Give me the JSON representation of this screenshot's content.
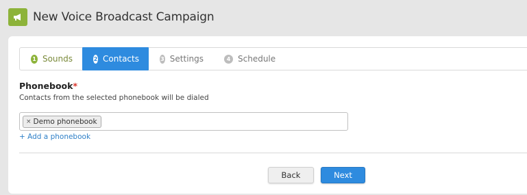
{
  "header": {
    "title": "New Voice Broadcast Campaign",
    "icon": "megaphone-icon",
    "icon_color": "#8db33a"
  },
  "tabs": [
    {
      "number": "1",
      "label": "Sounds",
      "state": "completed"
    },
    {
      "number": "2",
      "label": "Contacts",
      "state": "active"
    },
    {
      "number": "3",
      "label": "Settings",
      "state": "pending"
    },
    {
      "number": "4",
      "label": "Schedule",
      "state": "pending"
    }
  ],
  "form": {
    "label": "Phonebook",
    "required_marker": "*",
    "help_text": "Contacts from the selected phonebook will be dialed",
    "selected_tags": [
      {
        "remove": "×",
        "label": "Demo phonebook"
      }
    ],
    "add_link": "+ Add a phonebook"
  },
  "buttons": {
    "back_label": "Back",
    "next_label": "Next"
  },
  "colors": {
    "accent": "#2e8bdf",
    "success": "#8db33a",
    "required": "#d9342b",
    "link": "#2e7fc7"
  }
}
